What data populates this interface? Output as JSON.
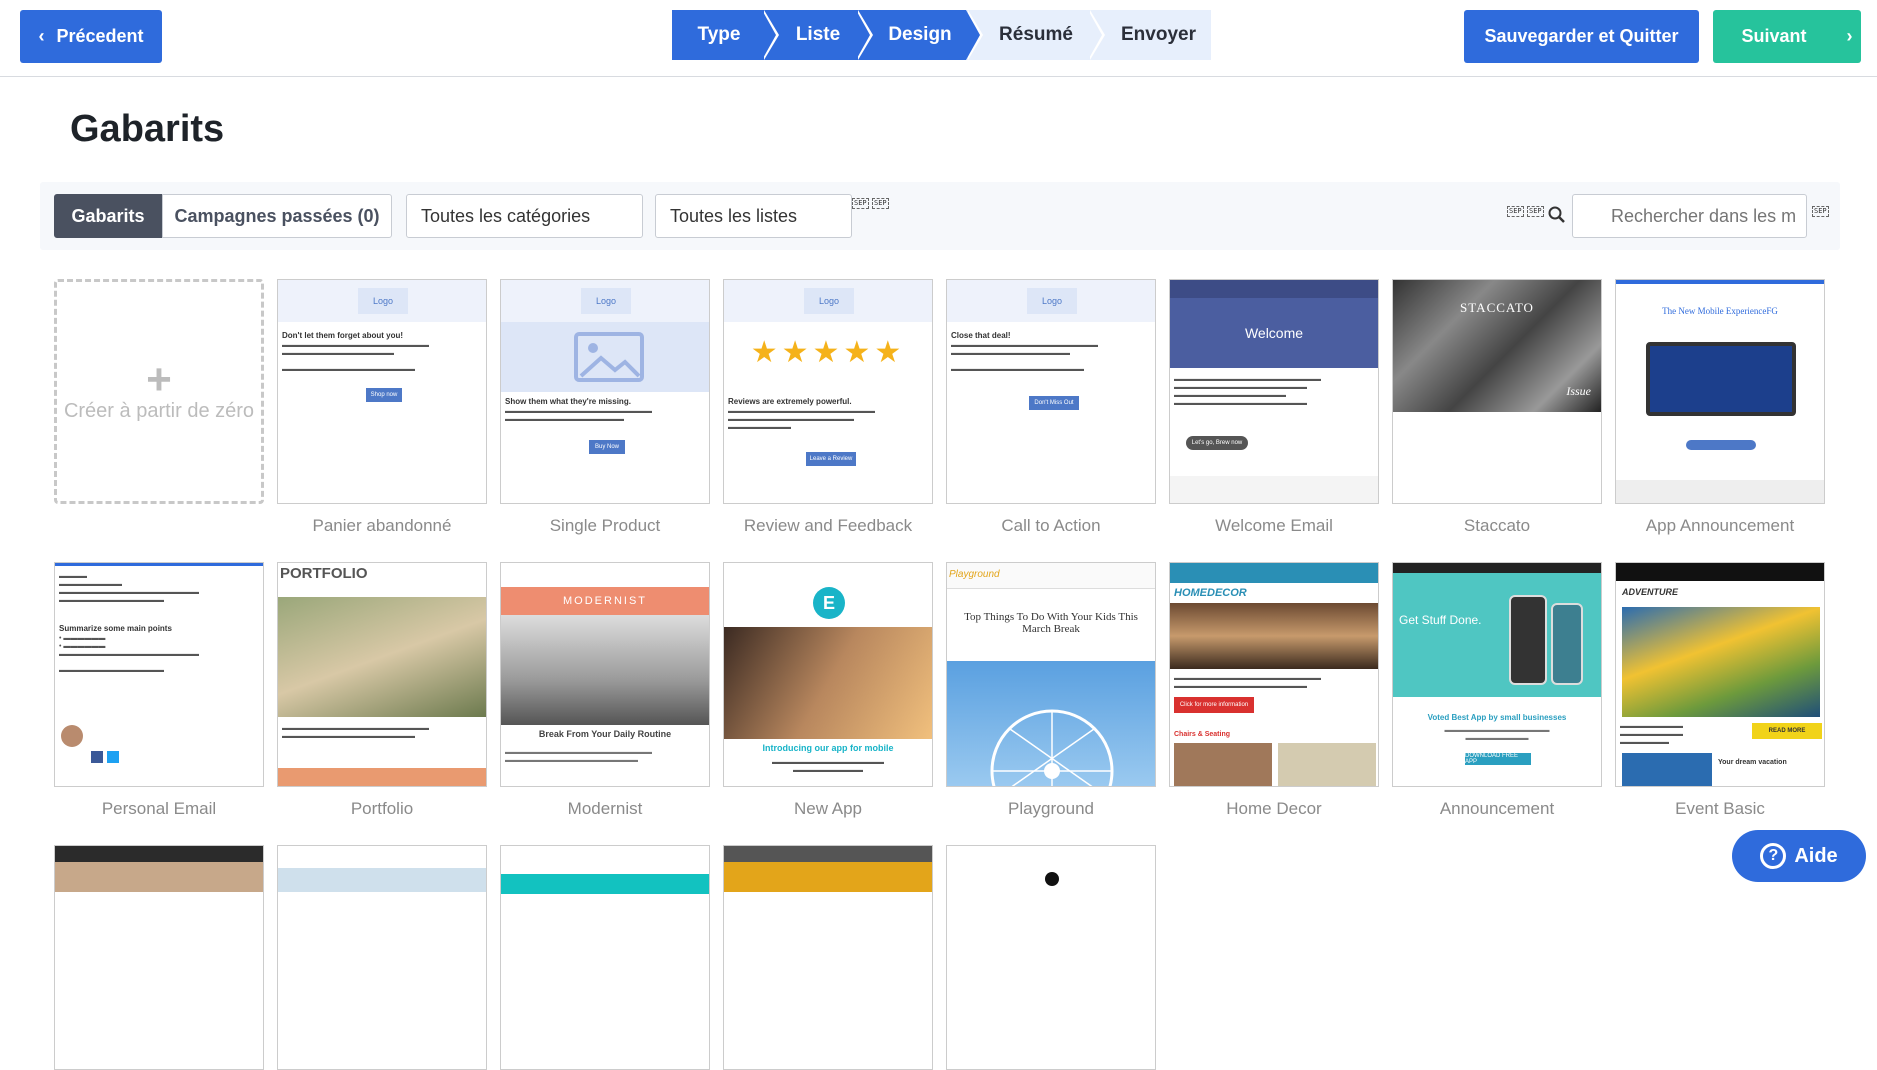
{
  "topbar": {
    "prev_label": "Précedent",
    "prev_icon": "‹",
    "steps": [
      "Type",
      "Liste",
      "Design",
      "Résumé",
      "Envoyer"
    ],
    "save_label": "Sauvegarder et Quitter",
    "next_label": "Suivant",
    "next_icon": "›"
  },
  "page_title": "Gabarits",
  "filters": {
    "tab_templates": "Gabarits",
    "tab_past": "Campagnes passées (0)",
    "category_select": "Toutes les catégories",
    "list_select": "Toutes les listes",
    "sep_tags": [
      "SEP",
      "SEP"
    ],
    "search_placeholder": "Rechercher dans les mo"
  },
  "create_blank": {
    "icon": "+",
    "label": "Créer à partir de zéro"
  },
  "templates_row1": [
    {
      "name": "Panier abandonné",
      "logo": "Logo",
      "heading": "Don't let them forget about you!",
      "button": "Shop now"
    },
    {
      "name": "Single Product",
      "logo": "Logo",
      "heading": "Show them what they're missing.",
      "button": "Buy Now"
    },
    {
      "name": "Review and Feedback",
      "logo": "Logo",
      "heading": "Reviews are extremely powerful.",
      "button": "Leave a Review"
    },
    {
      "name": "Call to Action",
      "logo": "Logo",
      "heading": "Close that deal!",
      "button": "Don't Miss Out"
    },
    {
      "name": "Welcome Email",
      "header": "Welcome",
      "button": "Let's go, Brew now"
    },
    {
      "name": "Staccato",
      "header": "STACCATO",
      "tag": "Issue"
    },
    {
      "name": "App Announcement",
      "header": "The New Mobile ExperienceFG"
    }
  ],
  "templates_row2": [
    {
      "name": "Personal Email",
      "heading": "Summarize some main points"
    },
    {
      "name": "Portfolio",
      "header": "PORTFOLIO"
    },
    {
      "name": "Modernist",
      "header": "MODERNIST",
      "heading": "Break From Your Daily Routine"
    },
    {
      "name": "New App",
      "heading": "Introducing our app for mobile"
    },
    {
      "name": "Playground",
      "header": "Playground",
      "heading": "Top Things To Do With Your Kids This March Break"
    },
    {
      "name": "Home Decor",
      "header": "HOMEDECOR",
      "button": "Click for more information",
      "heading": "Chairs & Seating"
    },
    {
      "name": "Announcement",
      "header": "Get Stuff Done.",
      "heading": "Voted Best App by small businesses",
      "button": "DOWNLOAD FREE APP"
    },
    {
      "name": "Event Basic",
      "header": "ADVENTURE",
      "button": "READ MORE",
      "heading": "Your dream vacation"
    }
  ],
  "help": {
    "label": "Aide",
    "icon": "?"
  },
  "colors": {
    "primary": "#2f6bdc",
    "success": "#26c39c",
    "dark_tab": "#4a5160",
    "step_todo": "#e7effc"
  }
}
